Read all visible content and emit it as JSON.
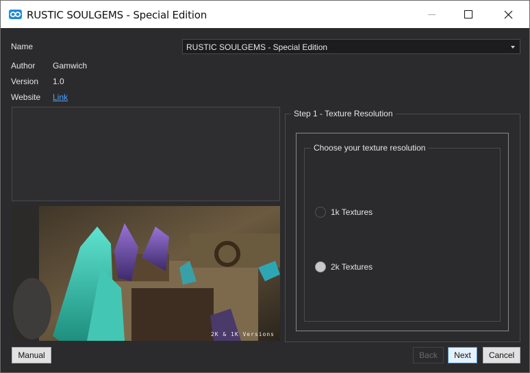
{
  "window": {
    "title": "RUSTIC SOULGEMS - Special Edition",
    "icon": "infinity-app-icon"
  },
  "info": {
    "name_label": "Name",
    "name_value": "RUSTIC SOULGEMS - Special Edition",
    "author_label": "Author",
    "author_value": "Gamwich",
    "version_label": "Version",
    "version_value": "1.0",
    "website_label": "Website",
    "website_link_text": "Link"
  },
  "preview": {
    "caption": "2K & 1K Versions"
  },
  "step": {
    "title": "Step 1 - Texture Resolution",
    "group_title": "Choose your texture resolution",
    "options": [
      {
        "label": "1k Textures",
        "selected": false
      },
      {
        "label": "2k Textures",
        "selected": true
      }
    ]
  },
  "buttons": {
    "manual": "Manual",
    "back": "Back",
    "next": "Next",
    "cancel": "Cancel"
  }
}
